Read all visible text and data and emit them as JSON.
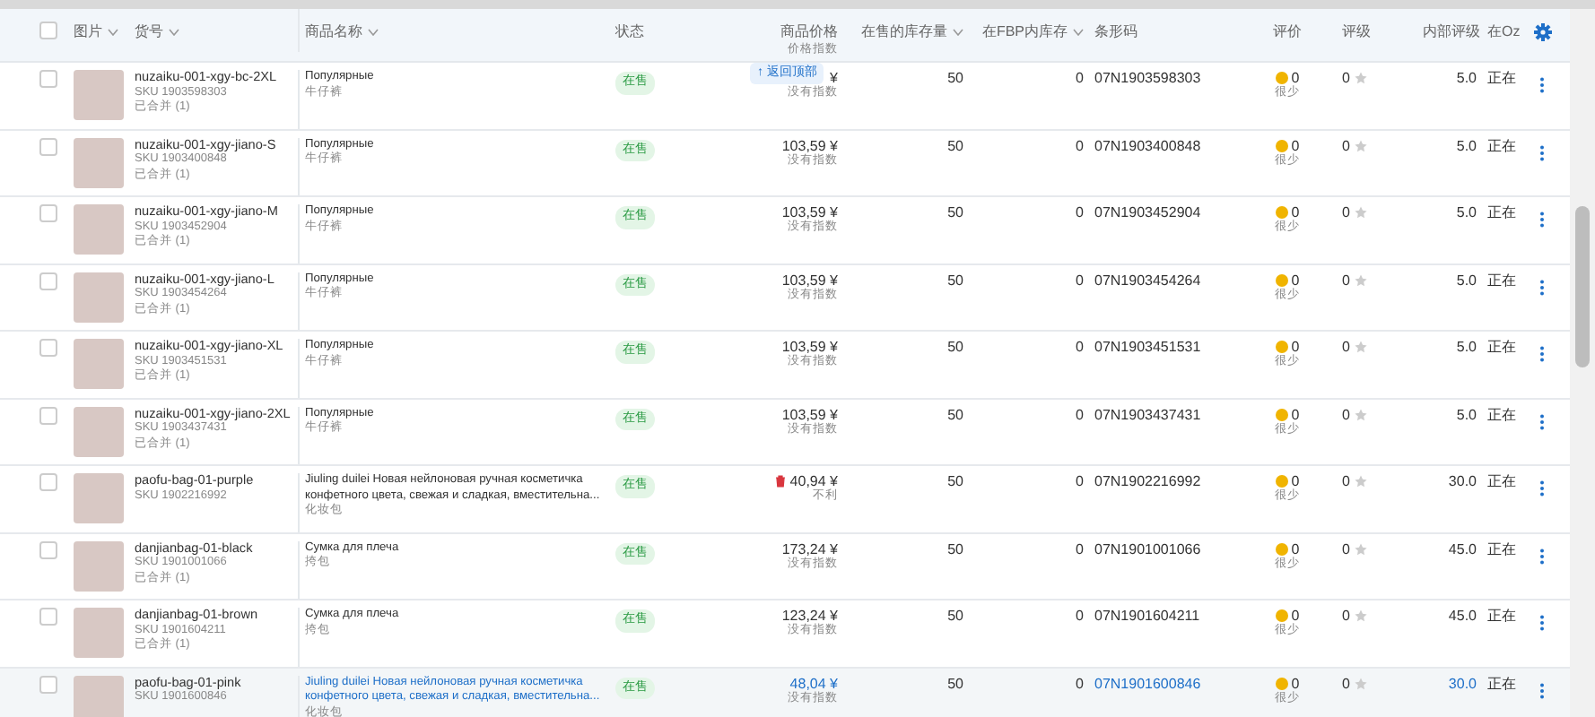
{
  "header": {
    "select_all_checked": false,
    "columns": [
      {
        "label": "图片",
        "sortable": true
      },
      {
        "label": "货号",
        "sortable": true
      },
      {
        "label": "商品名称",
        "sortable": true
      },
      {
        "label": "状态"
      },
      {
        "label": "商品价格",
        "sub": "价格指数"
      },
      {
        "label": "在售的库存量",
        "sortable": true
      },
      {
        "label": "在FBP内库存",
        "sortable": true
      },
      {
        "label": "条形码"
      },
      {
        "label": "评价"
      },
      {
        "label": "评级"
      },
      {
        "label": "内部评级"
      },
      {
        "label": "在Oz"
      }
    ]
  },
  "back_to_top": {
    "label": "↑ 返回顶部"
  },
  "rows": [
    {
      "checked": false,
      "hovered": false,
      "article": "nuzaiku-001-xgy-bc-2XL",
      "sku": "SKU 1903598303",
      "merged": "已合并 (1)",
      "name": "Популярные",
      "category": "牛仔裤",
      "status": "在售",
      "price": "¥",
      "price_note": "没有指数",
      "price_alert": false,
      "stock": "50",
      "fbp": "0",
      "barcode": "07N1903598303",
      "rating": "0",
      "rating_note": "很少",
      "star_count": "0",
      "internal": "5.0",
      "state": "正在"
    },
    {
      "checked": false,
      "hovered": false,
      "article": "nuzaiku-001-xgy-jiano-S",
      "sku": "SKU 1903400848",
      "merged": "已合并 (1)",
      "name": "Популярные",
      "category": "牛仔裤",
      "status": "在售",
      "price": "103,59 ¥",
      "price_note": "没有指数",
      "price_alert": false,
      "stock": "50",
      "fbp": "0",
      "barcode": "07N1903400848",
      "rating": "0",
      "rating_note": "很少",
      "star_count": "0",
      "internal": "5.0",
      "state": "正在"
    },
    {
      "checked": false,
      "hovered": false,
      "article": "nuzaiku-001-xgy-jiano-M",
      "sku": "SKU 1903452904",
      "merged": "已合并 (1)",
      "name": "Популярные",
      "category": "牛仔裤",
      "status": "在售",
      "price": "103,59 ¥",
      "price_note": "没有指数",
      "price_alert": false,
      "stock": "50",
      "fbp": "0",
      "barcode": "07N1903452904",
      "rating": "0",
      "rating_note": "很少",
      "star_count": "0",
      "internal": "5.0",
      "state": "正在"
    },
    {
      "checked": false,
      "hovered": false,
      "article": "nuzaiku-001-xgy-jiano-L",
      "sku": "SKU 1903454264",
      "merged": "已合并 (1)",
      "name": "Популярные",
      "category": "牛仔裤",
      "status": "在售",
      "price": "103,59 ¥",
      "price_note": "没有指数",
      "price_alert": false,
      "stock": "50",
      "fbp": "0",
      "barcode": "07N1903454264",
      "rating": "0",
      "rating_note": "很少",
      "star_count": "0",
      "internal": "5.0",
      "state": "正在"
    },
    {
      "checked": false,
      "hovered": false,
      "article": "nuzaiku-001-xgy-jiano-XL",
      "sku": "SKU 1903451531",
      "merged": "已合并 (1)",
      "name": "Популярные",
      "category": "牛仔裤",
      "status": "在售",
      "price": "103,59 ¥",
      "price_note": "没有指数",
      "price_alert": false,
      "stock": "50",
      "fbp": "0",
      "barcode": "07N1903451531",
      "rating": "0",
      "rating_note": "很少",
      "star_count": "0",
      "internal": "5.0",
      "state": "正在"
    },
    {
      "checked": false,
      "hovered": false,
      "article": "nuzaiku-001-xgy-jiano-2XL",
      "sku": "SKU 1903437431",
      "merged": "已合并 (1)",
      "name": "Популярные",
      "category": "牛仔裤",
      "status": "在售",
      "price": "103,59 ¥",
      "price_note": "没有指数",
      "price_alert": false,
      "stock": "50",
      "fbp": "0",
      "barcode": "07N1903437431",
      "rating": "0",
      "rating_note": "很少",
      "star_count": "0",
      "internal": "5.0",
      "state": "正在"
    },
    {
      "checked": false,
      "hovered": false,
      "article": "paofu-bag-01-purple",
      "sku": "SKU 1902216992",
      "name": "Jiuling duilei Новая нейлоновая ручная косметичка конфетного цвета, свежая и сладкая, вместительна...",
      "category": "化妆包",
      "status": "在售",
      "price": "40,94 ¥",
      "price_note": "不利",
      "price_alert": true,
      "stock": "50",
      "fbp": "0",
      "barcode": "07N1902216992",
      "rating": "0",
      "rating_note": "很少",
      "star_count": "0",
      "internal": "30.0",
      "state": "正在"
    },
    {
      "checked": false,
      "hovered": false,
      "article": "danjianbag-01-black",
      "sku": "SKU 1901001066",
      "merged": "已合并 (1)",
      "name": "Сумка для плеча",
      "category": "挎包",
      "status": "在售",
      "price": "173,24 ¥",
      "price_note": "没有指数",
      "price_alert": false,
      "stock": "50",
      "fbp": "0",
      "barcode": "07N1901001066",
      "rating": "0",
      "rating_note": "很少",
      "star_count": "0",
      "internal": "45.0",
      "state": "正在"
    },
    {
      "checked": false,
      "hovered": false,
      "article": "danjianbag-01-brown",
      "sku": "SKU 1901604211",
      "merged": "已合并 (1)",
      "name": "Сумка для плеча",
      "category": "挎包",
      "status": "在售",
      "price": "123,24 ¥",
      "price_note": "没有指数",
      "price_alert": false,
      "stock": "50",
      "fbp": "0",
      "barcode": "07N1901604211",
      "rating": "0",
      "rating_note": "很少",
      "star_count": "0",
      "internal": "45.0",
      "state": "正在"
    },
    {
      "checked": false,
      "hovered": true,
      "article": "paofu-bag-01-pink",
      "sku": "SKU 1901600846",
      "name": "Jiuling duilei Новая нейлоновая ручная косметичка конфетного цвета, свежая и сладкая, вместительна...",
      "category": "化妆包",
      "status": "在售",
      "price": "48,04 ¥",
      "price_note": "没有指数",
      "price_alert": false,
      "stock": "50",
      "fbp": "0",
      "barcode": "07N1901600846",
      "rating": "0",
      "rating_note": "很少",
      "star_count": "0",
      "internal": "30.0",
      "state": "正在"
    }
  ]
}
